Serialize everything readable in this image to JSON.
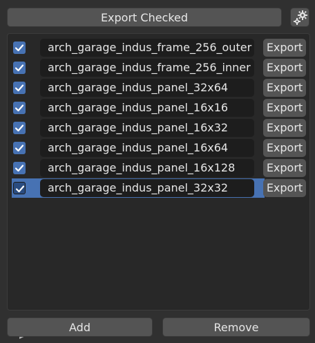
{
  "toolbar": {
    "export_checked_label": "Export Checked",
    "settings_icon": "gear-icon"
  },
  "list": {
    "items": [
      {
        "name": "arch_garage_indus_frame_256_outer",
        "checked": true,
        "export_label": "Export",
        "selected": false
      },
      {
        "name": "arch_garage_indus_frame_256_inner",
        "checked": true,
        "export_label": "Export",
        "selected": false
      },
      {
        "name": "arch_garage_indus_panel_32x64",
        "checked": true,
        "export_label": "Export",
        "selected": false
      },
      {
        "name": "arch_garage_indus_panel_16x16",
        "checked": true,
        "export_label": "Export",
        "selected": false
      },
      {
        "name": "arch_garage_indus_panel_16x32",
        "checked": true,
        "export_label": "Export",
        "selected": false
      },
      {
        "name": "arch_garage_indus_panel_16x64",
        "checked": true,
        "export_label": "Export",
        "selected": false
      },
      {
        "name": "arch_garage_indus_panel_16x128",
        "checked": true,
        "export_label": "Export",
        "selected": false
      },
      {
        "name": "arch_garage_indus_panel_32x32",
        "checked": true,
        "export_label": "Export",
        "selected": true
      }
    ],
    "expand_icon": "triangle-right-icon",
    "grip_text": "::::"
  },
  "footer": {
    "add_label": "Add",
    "remove_label": "Remove"
  },
  "colors": {
    "accent": "#4772b3",
    "background": "#303030",
    "button": "#545454",
    "field": "#1d1d1d"
  }
}
